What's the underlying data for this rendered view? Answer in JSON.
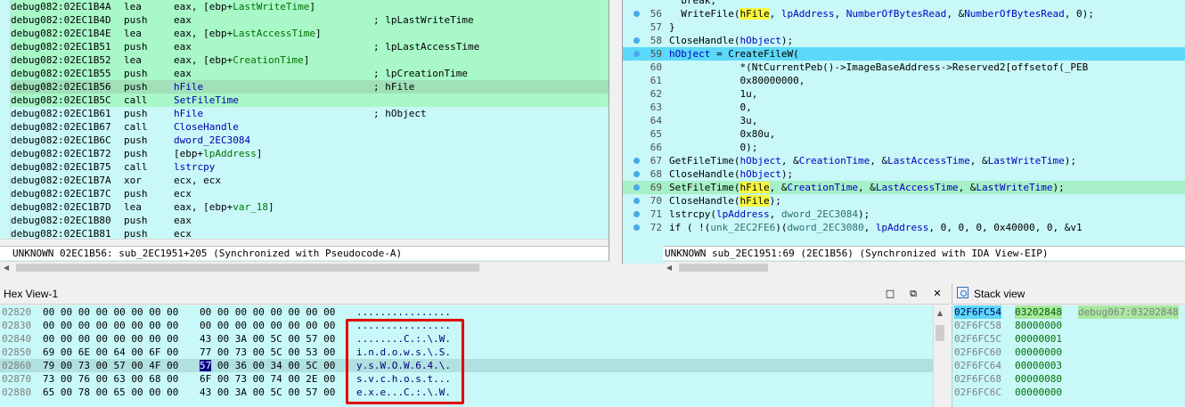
{
  "disasm": {
    "lines": [
      {
        "addr": "debug082:02EC1B4A",
        "mn": "lea",
        "op": "eax, [ebp+LastWriteTime]",
        "sym": "LastWriteTime",
        "cm": "",
        "style": "green"
      },
      {
        "addr": "debug082:02EC1B4D",
        "mn": "push",
        "op": "eax",
        "cm": "; lpLastWriteTime",
        "style": "green"
      },
      {
        "addr": "debug082:02EC1B4E",
        "mn": "lea",
        "op": "eax, [ebp+LastAccessTime]",
        "cm": "",
        "style": "green"
      },
      {
        "addr": "debug082:02EC1B51",
        "mn": "push",
        "op": "eax",
        "cm": "; lpLastAccessTime",
        "style": "green"
      },
      {
        "addr": "debug082:02EC1B52",
        "mn": "lea",
        "op": "eax, [ebp+CreationTime]",
        "cm": "",
        "style": "green"
      },
      {
        "addr": "debug082:02EC1B55",
        "mn": "push",
        "op": "eax",
        "cm": "; lpCreationTime",
        "style": "green"
      },
      {
        "addr": "debug082:02EC1B56",
        "mn": "push",
        "op": "hFile",
        "cm": "; hFile",
        "style": "cur"
      },
      {
        "addr": "debug082:02EC1B5C",
        "mn": "call",
        "op": "SetFileTime",
        "cm": "",
        "style": "green"
      },
      {
        "addr": "debug082:02EC1B61",
        "mn": "push",
        "op": "hFile",
        "cm": "; hObject",
        "style": ""
      },
      {
        "addr": "debug082:02EC1B67",
        "mn": "call",
        "op": "CloseHandle",
        "cm": "",
        "style": ""
      },
      {
        "addr": "debug082:02EC1B6C",
        "mn": "push",
        "op": "dword_2EC3084",
        "cm": "",
        "style": ""
      },
      {
        "addr": "debug082:02EC1B72",
        "mn": "push",
        "op": "[ebp+lpAddress]",
        "cm": "",
        "style": ""
      },
      {
        "addr": "debug082:02EC1B75",
        "mn": "call",
        "op": "lstrcpy",
        "cm": "",
        "style": ""
      },
      {
        "addr": "debug082:02EC1B7A",
        "mn": "xor",
        "op": "ecx, ecx",
        "cm": "",
        "style": ""
      },
      {
        "addr": "debug082:02EC1B7C",
        "mn": "push",
        "op": "ecx",
        "cm": "",
        "style": ""
      },
      {
        "addr": "debug082:02EC1B7D",
        "mn": "lea",
        "op": "eax, [ebp+var_18]",
        "cm": "",
        "style": ""
      },
      {
        "addr": "debug082:02EC1B80",
        "mn": "push",
        "op": "eax",
        "cm": "",
        "style": ""
      },
      {
        "addr": "debug082:02EC1B81",
        "mn": "push",
        "op": "ecx",
        "cm": "",
        "style": ""
      }
    ],
    "status": "UNKNOWN 02EC1B56: sub_2EC1951+205 (Synchronized with Pseudocode-A)"
  },
  "pseudo": {
    "lines": [
      {
        "ln": "",
        "dot": false,
        "code": "  break;",
        "style": ""
      },
      {
        "ln": "56",
        "dot": true,
        "code": "  WriteFile(hFile, lpAddress, NumberOfBytesRead, &NumberOfBytesRead, 0);",
        "style": ""
      },
      {
        "ln": "57",
        "dot": false,
        "code": "}",
        "style": ""
      },
      {
        "ln": "58",
        "dot": true,
        "code": "CloseHandle(hObject);",
        "style": ""
      },
      {
        "ln": "59",
        "dot": true,
        "code": "hObject = CreateFileW(",
        "style": "sel"
      },
      {
        "ln": "60",
        "dot": false,
        "code": "            *(NtCurrentPeb()->ImageBaseAddress->Reserved2[offsetof(_PEB",
        "style": ""
      },
      {
        "ln": "61",
        "dot": false,
        "code": "            0x80000000,",
        "style": ""
      },
      {
        "ln": "62",
        "dot": false,
        "code": "            1u,",
        "style": ""
      },
      {
        "ln": "63",
        "dot": false,
        "code": "            0,",
        "style": ""
      },
      {
        "ln": "64",
        "dot": false,
        "code": "            3u,",
        "style": ""
      },
      {
        "ln": "65",
        "dot": false,
        "code": "            0x80u,",
        "style": ""
      },
      {
        "ln": "66",
        "dot": false,
        "code": "            0);",
        "style": ""
      },
      {
        "ln": "67",
        "dot": true,
        "code": "GetFileTime(hObject, &CreationTime, &LastAccessTime, &LastWriteTime);",
        "style": ""
      },
      {
        "ln": "68",
        "dot": true,
        "code": "CloseHandle(hObject);",
        "style": ""
      },
      {
        "ln": "69",
        "dot": true,
        "code": "SetFileTime(hFile, &CreationTime, &LastAccessTime, &LastWriteTime);",
        "style": "cur"
      },
      {
        "ln": "70",
        "dot": true,
        "code": "CloseHandle(hFile);",
        "style": ""
      },
      {
        "ln": "71",
        "dot": true,
        "code": "lstrcpy(lpAddress, dword_2EC3084);",
        "style": ""
      },
      {
        "ln": "72",
        "dot": true,
        "code": "if ( !(unk_2EC2FE6)(dword_2EC3080, lpAddress, 0, 0, 0, 0x40000, 0, &v1",
        "style": ""
      }
    ],
    "status": "UNKNOWN sub_2EC1951:69 (2EC1B56) (Synchronized with IDA View-EIP)"
  },
  "hex": {
    "title": "Hex View-1",
    "lines": [
      {
        "addr": "02820",
        "b1": "00 00 00 00 00 00 00 00",
        "b2": "00 00 00 00 00 00 00 00",
        "asc": "................"
      },
      {
        "addr": "02830",
        "b1": "00 00 00 00 00 00 00 00",
        "b2": "00 00 00 00 00 00 00 00",
        "asc": "................"
      },
      {
        "addr": "02840",
        "b1": "00 00 00 00 00 00 00 00",
        "b2": "43 00 3A 00 5C 00 57 00",
        "asc": "........C.:.\\.W."
      },
      {
        "addr": "02850",
        "b1": "69 00 6E 00 64 00 6F 00",
        "b2": "77 00 73 00 5C 00 53 00",
        "asc": "i.n.d.o.w.s.\\.S."
      },
      {
        "addr": "02860",
        "b1": "79 00 73 00 57 00 4F 00",
        "b2": "57 00 36 00 34 00 5C 00",
        "asc": "y.s.W.O.W.6.4.\\.",
        "sel": "57"
      },
      {
        "addr": "02870",
        "b1": "73 00 76 00 63 00 68 00",
        "b2": "6F 00 73 00 74 00 2E 00",
        "asc": "s.v.c.h.o.s.t..."
      },
      {
        "addr": "02880",
        "b1": "65 00 78 00 65 00 00 00",
        "b2": "43 00 3A 00 5C 00 57 00",
        "asc": "e.x.e...C.:.\\.W."
      }
    ]
  },
  "stack": {
    "title": "Stack view",
    "lines": [
      {
        "addr": "02F6FC54",
        "val": "03202848",
        "cm": "debug067:03202848"
      },
      {
        "addr": "02F6FC58",
        "val": "80000000",
        "cm": ""
      },
      {
        "addr": "02F6FC5C",
        "val": "00000001",
        "cm": ""
      },
      {
        "addr": "02F6FC60",
        "val": "00000000",
        "cm": ""
      },
      {
        "addr": "02F6FC64",
        "val": "00000003",
        "cm": ""
      },
      {
        "addr": "02F6FC68",
        "val": "00000080",
        "cm": ""
      },
      {
        "addr": "02F6FC6C",
        "val": "00000000",
        "cm": ""
      }
    ]
  },
  "icons": {
    "maximize": "□",
    "restore": "⧉",
    "close": "✕",
    "up": "▲",
    "down": "▼",
    "left": "◀",
    "right": "▶"
  }
}
